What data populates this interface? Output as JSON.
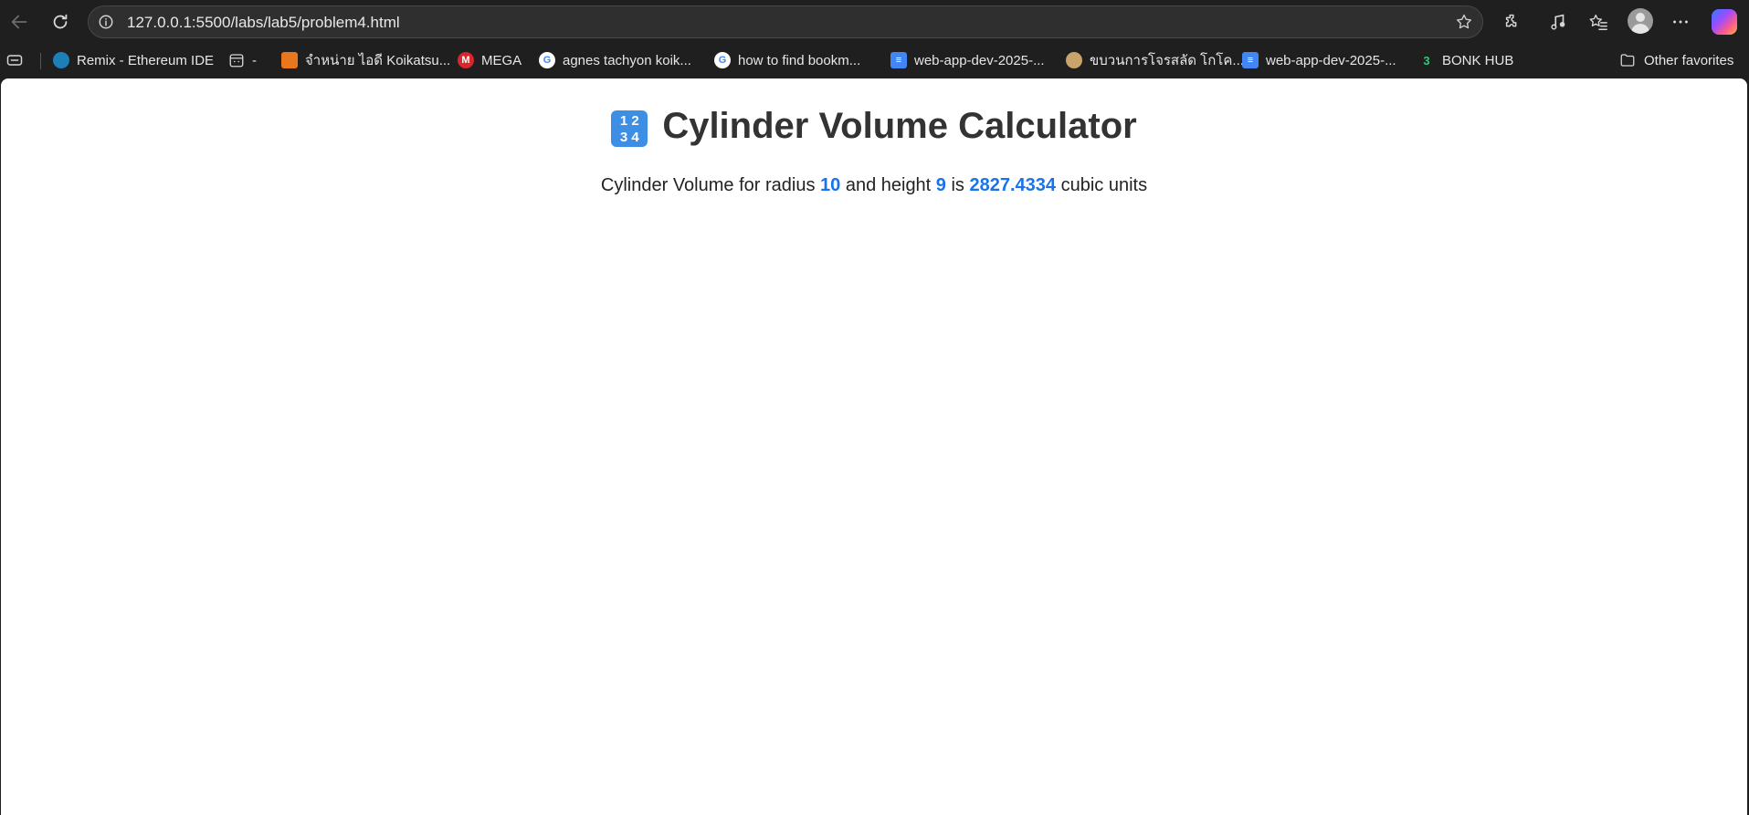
{
  "browser": {
    "url": "127.0.0.1:5500/labs/lab5/problem4.html",
    "bookmarks": [
      {
        "label": "Remix - Ethereum IDE",
        "icon": "remix-icon"
      },
      {
        "label": "-",
        "icon": "calendar-icon"
      },
      {
        "label": "จำหน่าย ไอดี Koikatsu...",
        "icon": "shop-icon"
      },
      {
        "label": "MEGA",
        "icon": "mega-icon"
      },
      {
        "label": "agnes tachyon koik...",
        "icon": "google-icon"
      },
      {
        "label": "how to find bookm...",
        "icon": "google-icon"
      },
      {
        "label": "web-app-dev-2025-...",
        "icon": "docs-icon"
      },
      {
        "label": "ขบวนการโจรสลัด โกโค...",
        "icon": "doge-icon"
      },
      {
        "label": "web-app-dev-2025-...",
        "icon": "docs-icon"
      },
      {
        "label": "BONK HUB",
        "icon": "bonk-icon"
      }
    ],
    "other_favorites": "Other favorites"
  },
  "page": {
    "emoji": "1 2\n3 4",
    "title": "Cylinder Volume Calculator",
    "result": {
      "prefix": "Cylinder Volume for radius ",
      "radius": "10",
      "mid1": " and height ",
      "height": "9",
      "mid2": " is ",
      "volume": "2827.4334",
      "suffix": " cubic units"
    }
  },
  "colors": {
    "highlight": "#1a73e8",
    "title": "#333333"
  }
}
